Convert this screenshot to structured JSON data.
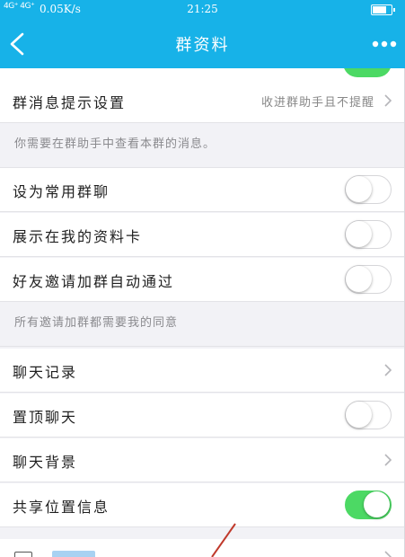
{
  "status_bar": {
    "signal": "4G⁺ 4G⁺",
    "net_speed": "0.05K/s",
    "time": "21:25"
  },
  "nav": {
    "title": "群资料"
  },
  "message_setting": {
    "label": "群消息提示设置",
    "value": "收进群助手且不提醒"
  },
  "hint_message": "你需要在群助手中查看本群的消息。",
  "toggles": [
    {
      "label": "设为常用群聊",
      "on": false
    },
    {
      "label": "展示在我的资料卡",
      "on": false
    },
    {
      "label": "好友邀请加群自动通过",
      "on": false
    }
  ],
  "hint_invite": "所有邀请加群都需要我的同意",
  "chat_records": {
    "label": "聊天记录"
  },
  "pin_chat": {
    "label": "置顶聊天",
    "on": false
  },
  "chat_background": {
    "label": "聊天背景"
  },
  "share_location": {
    "label": "共享位置信息",
    "on": true
  },
  "colors": {
    "header": "#17b2e8",
    "toggle_on": "#4cd964",
    "background": "#f2f2f6"
  }
}
